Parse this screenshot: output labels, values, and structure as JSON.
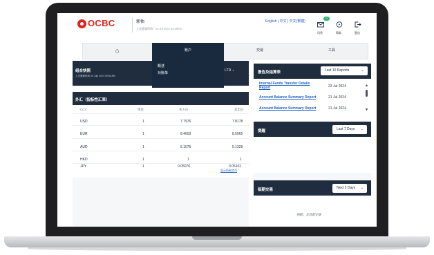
{
  "header": {
    "logo_text": "OCBC",
    "user_name": "郭佑",
    "last_login": "上次登录时间：24 Jul 2024 04:48PM",
    "language_links": "English | 中文 | 中文(繁體)",
    "badge_count": "0",
    "icons": [
      {
        "name": "mail-icon",
        "label": "讯息"
      },
      {
        "name": "help-icon",
        "label": "帮助"
      },
      {
        "name": "logout-icon",
        "label": "登出"
      }
    ]
  },
  "nav": {
    "items": [
      {
        "name": "home-icon",
        "label": "⌂"
      },
      {
        "label": "账户"
      },
      {
        "label": "交易"
      },
      {
        "label": "工具"
      }
    ],
    "dropdown": [
      "概述",
      "对账单"
    ]
  },
  "portfolio": {
    "title": "组合快照",
    "subtitle": "上次更新时间 30 July 2024 09:56 AM",
    "selected": "PTE LTD"
  },
  "fx": {
    "title": "外汇（指标性汇率）",
    "columns": [
      "CCY",
      "单位",
      "买入价",
      "卖出价"
    ],
    "rows": [
      {
        "ccy": "USD",
        "unit": "1",
        "buy": "7.7976",
        "sell": "7.8178"
      },
      {
        "ccy": "EUR",
        "unit": "1",
        "buy": "8.4603",
        "sell": "8.5065"
      },
      {
        "ccy": "AUD",
        "unit": "1",
        "buy": "5.1075",
        "sell": "5.1329"
      },
      {
        "ccy": "HKD",
        "unit": "1",
        "buy": "1",
        "sell": "1"
      },
      {
        "ccy": "JPY",
        "unit": "1",
        "buy": "0.05076",
        "sell": "0.05102"
      }
    ],
    "more_link": "显示所有货币"
  },
  "reports": {
    "title": "报告及结算表",
    "selected": "Last 10 Reports",
    "items": [
      {
        "name": "Internal Funds Transfer Details Report",
        "date": "23 Jul 2024"
      },
      {
        "name": "Account Balance Summary Report",
        "date": "21 Jul 2024"
      },
      {
        "name": "Account Balance Summary Report",
        "date": "21 Jul 2024"
      }
    ]
  },
  "alerts": {
    "title": "提醒",
    "selected": "Last 7 Days"
  },
  "upcoming": {
    "title": "临期交易",
    "selected": "Next 3 Days",
    "empty_text": "抱歉，无匹配记录"
  },
  "colors": {
    "brand_red": "#e2231a",
    "navy": "#1f2d3f",
    "link_blue": "#1f5fbf"
  }
}
